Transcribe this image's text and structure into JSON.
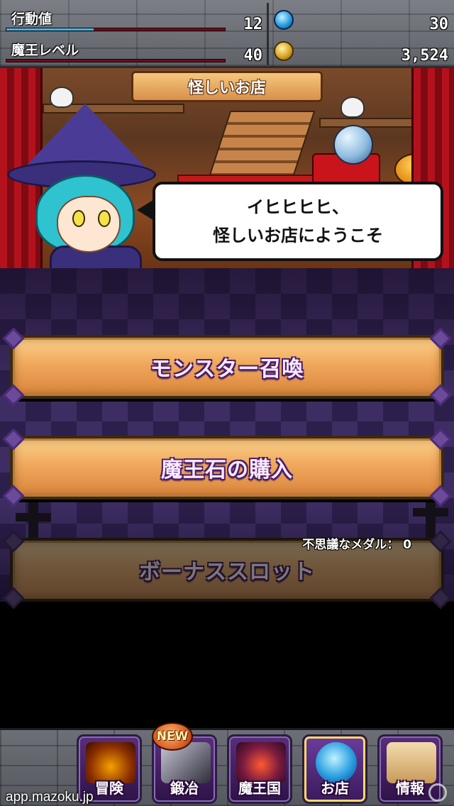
{
  "status": {
    "action_points": {
      "label": "行動値",
      "value": "12",
      "fill": 0.4,
      "fill_color": "#3ab8e8"
    },
    "demon_level": {
      "label": "魔王レベル",
      "value": "40",
      "fill": 0.0,
      "fill_color": "#e03040"
    },
    "magic_stones": {
      "value": "30",
      "icon": "blue-gem-icon"
    },
    "coins": {
      "value": "3,524",
      "icon": "gold-coin-icon"
    }
  },
  "scene": {
    "title": "怪しいお店",
    "speech_line1": "イヒヒヒヒ、",
    "speech_line2": "怪しいお店にようこそ"
  },
  "menu": {
    "summon_label": "モンスター召喚",
    "stone_label": "魔王石の購入",
    "slot_label": "ボーナススロット",
    "medal_label": "不思議なメダル：",
    "medal_count": "0"
  },
  "nav": {
    "new_badge": "NEW",
    "items": [
      {
        "label": "冒険",
        "icon": "adventure-icon"
      },
      {
        "label": "鍛冶",
        "icon": "forge-icon"
      },
      {
        "label": "魔王国",
        "icon": "demon-kingdom-icon"
      },
      {
        "label": "お店",
        "icon": "shop-icon",
        "active": true
      },
      {
        "label": "情報",
        "icon": "info-scroll-icon"
      }
    ]
  },
  "watermark": "app.mazoku.jp"
}
